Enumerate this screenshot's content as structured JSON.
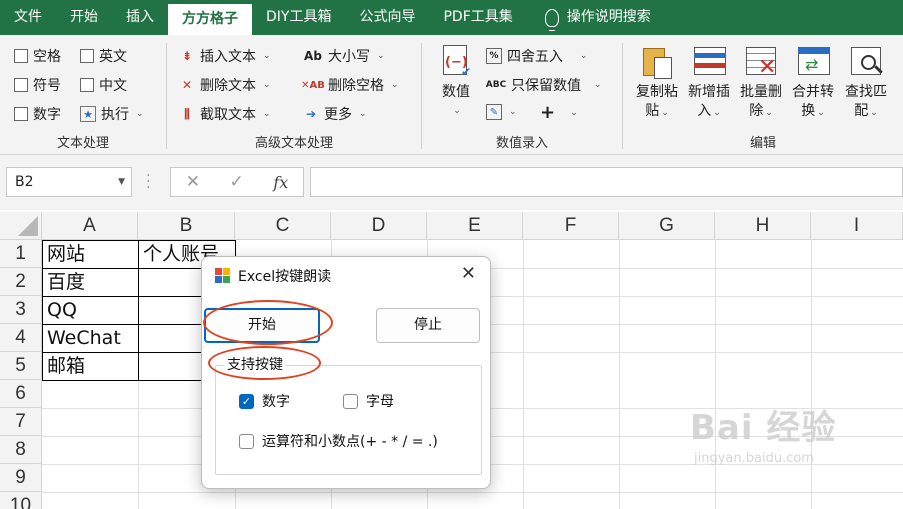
{
  "ribbon_tabs": [
    "文件",
    "开始",
    "插入",
    "方方格子",
    "DIY工具箱",
    "公式向导",
    "PDF工具集",
    "操作说明搜索"
  ],
  "active_tab": "方方格子",
  "groups": {
    "text": {
      "title": "文本处理",
      "items": [
        "空格",
        "英文",
        "符号",
        "中文",
        "数字",
        "执行"
      ]
    },
    "advanced": {
      "title": "高级文本处理",
      "items": [
        "插入文本",
        "删除文本",
        "截取文本",
        "大小写",
        "删除空格",
        "更多"
      ]
    },
    "numbers": {
      "title": "数值录入",
      "big_button": "数值",
      "items": [
        "四舍五入",
        "只保留数值"
      ]
    },
    "edit": {
      "title": "编辑",
      "buttons": [
        [
          "复制粘",
          "贴"
        ],
        [
          "新增插",
          "入"
        ],
        [
          "批量删",
          "除"
        ],
        [
          "合并转",
          "换"
        ],
        [
          "查找匹",
          "配"
        ]
      ]
    }
  },
  "formula_bar": {
    "name_box": "B2",
    "fx": "fx",
    "value": ""
  },
  "sheet": {
    "columns": [
      "A",
      "B",
      "C",
      "D",
      "E",
      "F",
      "G",
      "H",
      "I"
    ],
    "rows": [
      "1",
      "2",
      "3",
      "4",
      "5",
      "6",
      "7",
      "8",
      "9",
      "10"
    ],
    "cells": {
      "A1": "网站",
      "B1": "个人账号",
      "A2": "百度",
      "A3": "QQ",
      "A4": "WeChat",
      "A5": "邮箱"
    }
  },
  "dialog": {
    "title": "Excel按键朗读",
    "start_label": "开始",
    "stop_label": "停止",
    "group_label": "支持按键",
    "options": [
      {
        "label": "数字",
        "checked": true
      },
      {
        "label": "字母",
        "checked": false
      },
      {
        "label": "运算符和小数点(+ - * / = .)",
        "checked": false
      }
    ]
  },
  "watermark": {
    "logo": "Bai 经验",
    "url": "jingyan.baidu.com"
  },
  "colors": {
    "ribbon": "#217346",
    "annotation": "#e2421d",
    "accent": "#0067c0"
  }
}
